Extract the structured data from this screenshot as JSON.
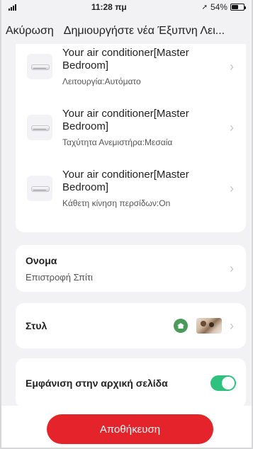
{
  "status_bar": {
    "time": "11:28 πμ",
    "battery": "54%",
    "battery_level": 0.54
  },
  "nav": {
    "cancel_label": "Ακύρωση",
    "title": "Δημιουργήστε νέα Έξυπνη Λει..."
  },
  "actions": [
    {
      "title": "Your air conditioner[Master Bedroom]",
      "subtitle": "Λειτουργία:Αυτόματο",
      "icon": "air-conditioner-icon"
    },
    {
      "title": "Your air conditioner[Master Bedroom]",
      "subtitle": "Ταχύτητα Ανεμιστήρα:Μεσαία",
      "icon": "air-conditioner-icon"
    },
    {
      "title": "Your air conditioner[Master Bedroom]",
      "subtitle": "Κάθετη κίνηση περσίδων:On",
      "icon": "air-conditioner-icon"
    }
  ],
  "name_section": {
    "label": "Ονομα",
    "value": "Επιστροφή Σπίτι"
  },
  "style_section": {
    "label": "Στυλ",
    "icon": "home-icon",
    "icon_color": "#4a9b5a"
  },
  "home_section": {
    "label": "Εμφάνιση στην αρχική σελίδα",
    "toggle_on": true,
    "toggle_color": "#2ec27e"
  },
  "save_label": "Αποθήκευση",
  "accent_color": "#e4232b"
}
